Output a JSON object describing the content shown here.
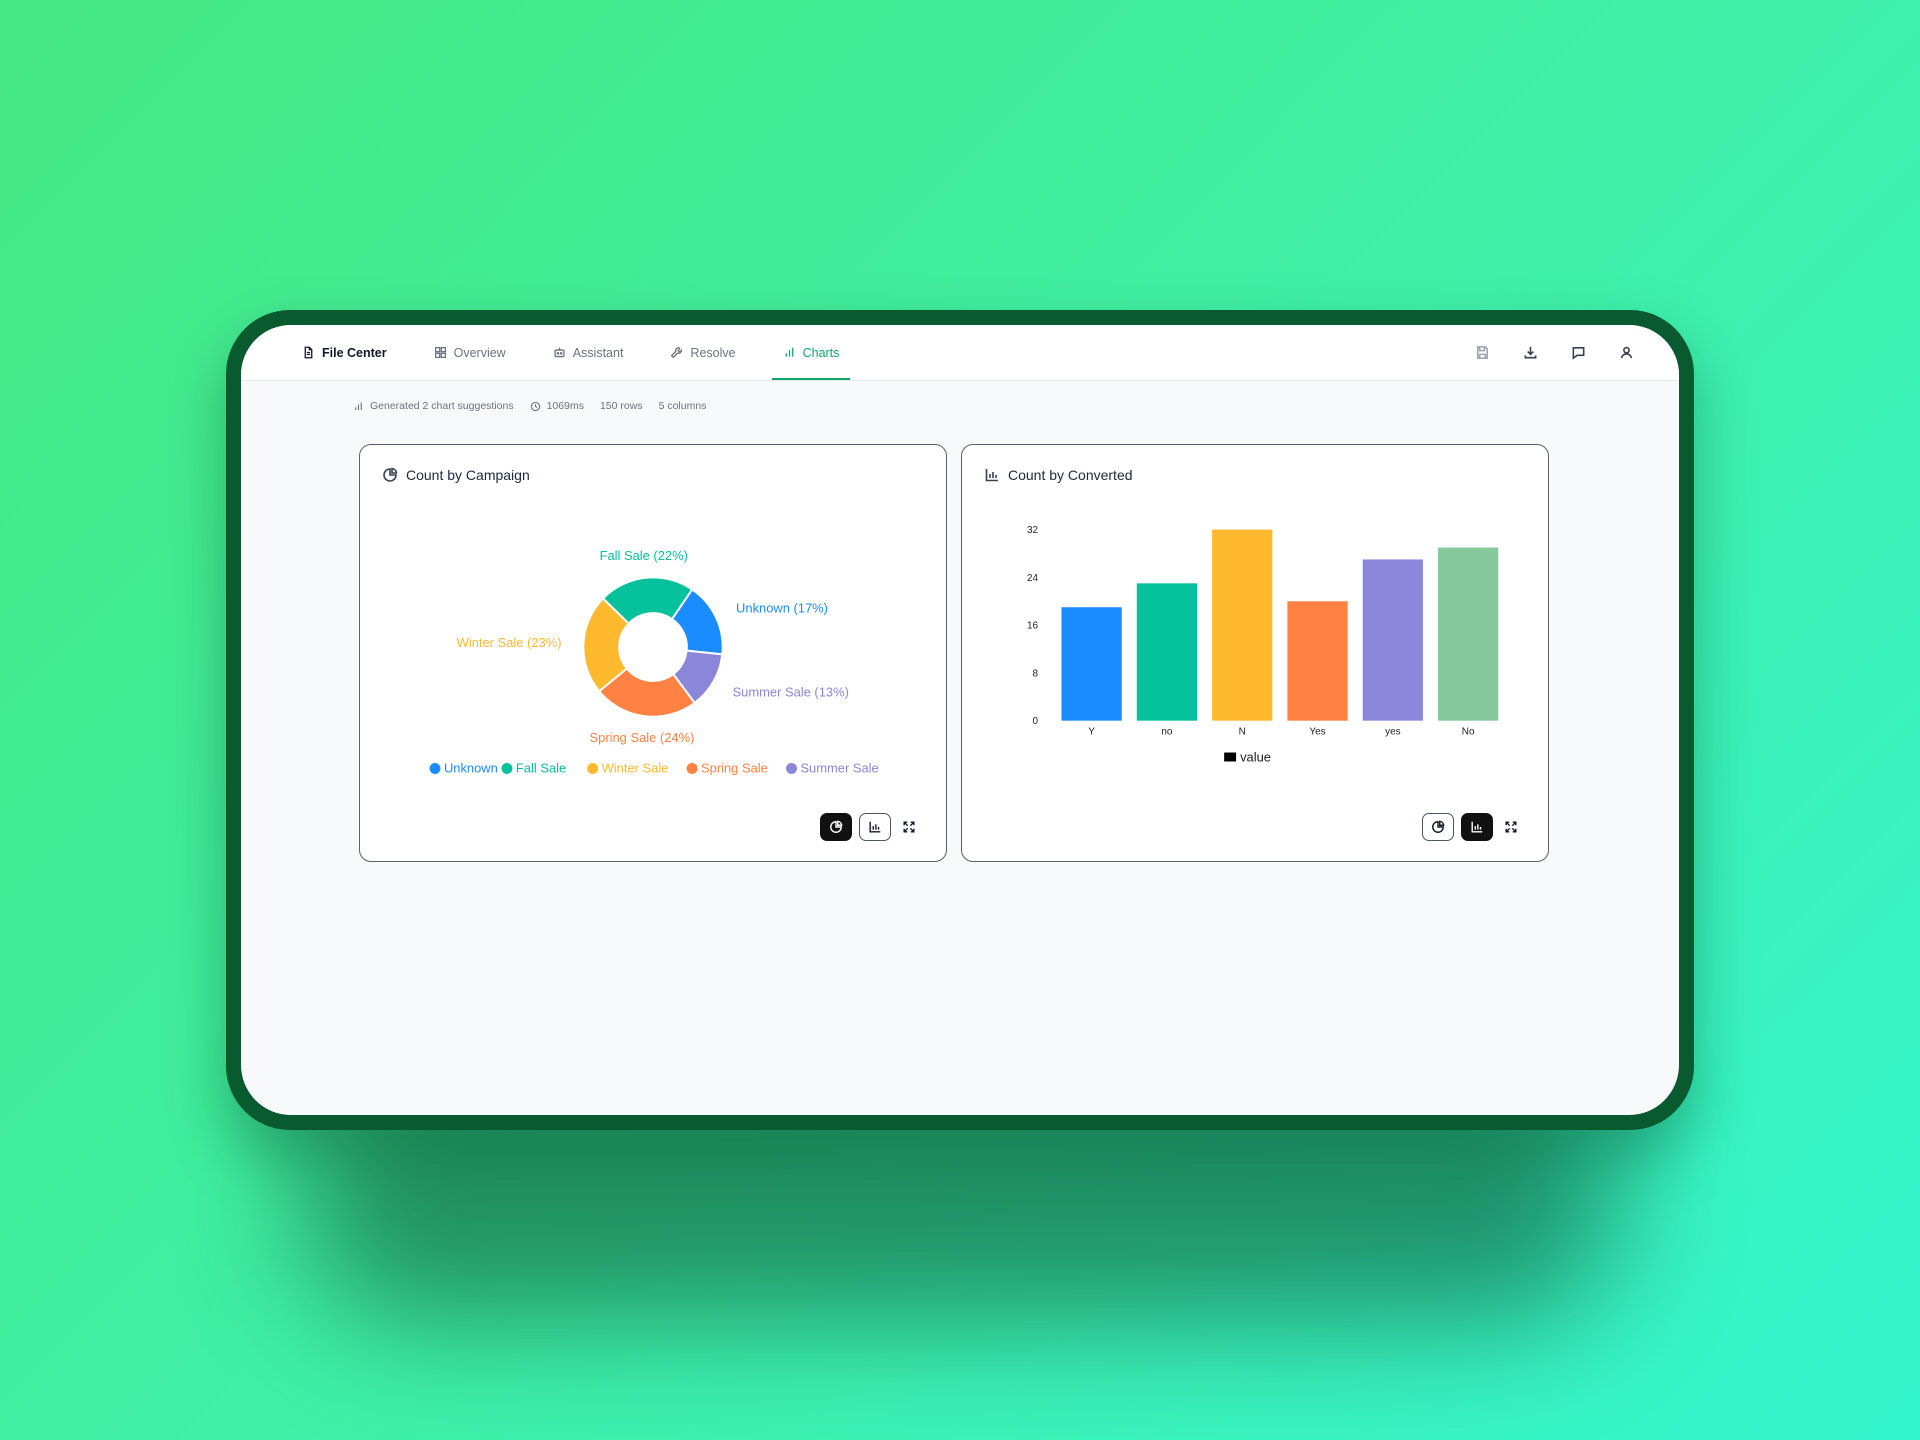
{
  "nav": {
    "tabs": [
      {
        "label": "File Center",
        "icon": "file-icon"
      },
      {
        "label": "Overview",
        "icon": "grid-icon"
      },
      {
        "label": "Assistant",
        "icon": "robot-icon"
      },
      {
        "label": "Resolve",
        "icon": "wrench-icon"
      },
      {
        "label": "Charts",
        "icon": "bar-chart-icon"
      }
    ],
    "active_tab": "Charts",
    "actions": [
      "save-icon",
      "download-icon",
      "comment-icon",
      "user-icon"
    ]
  },
  "meta": {
    "suggestions": "Generated 2 chart suggestions",
    "duration": "1069ms",
    "rows": "150 rows",
    "columns": "5 columns"
  },
  "colors": {
    "accent": "#10a56b",
    "blue": "#1a8cff",
    "teal": "#05c19c",
    "yellow": "#ffb92e",
    "orange": "#ff8243",
    "purple": "#8c86db",
    "green": "#85c99d"
  },
  "chart_data": [
    {
      "type": "pie",
      "title": "Count by Campaign",
      "categories": [
        "Unknown",
        "Summer Sale",
        "Spring Sale",
        "Winter Sale",
        "Fall Sale"
      ],
      "values": [
        17,
        13,
        24,
        23,
        22
      ],
      "slice_labels": [
        "Unknown (17%)",
        "Summer Sale (13%)",
        "Spring Sale (24%)",
        "Winter Sale (23%)",
        "Fall Sale (22%)"
      ],
      "colors": [
        "#1a8cff",
        "#8c86db",
        "#ff8243",
        "#ffb92e",
        "#05c19c"
      ],
      "legend": [
        "Unknown",
        "Fall Sale",
        "Winter Sale",
        "Spring Sale",
        "Summer Sale"
      ],
      "legend_colors": [
        "#1a8cff",
        "#05c19c",
        "#ffb92e",
        "#ff8243",
        "#8c86db"
      ],
      "legend_position": "bottom",
      "donut": true
    },
    {
      "type": "bar",
      "title": "Count by Converted",
      "categories": [
        "Y",
        "no",
        "N",
        "Yes",
        "yes",
        "No"
      ],
      "values": [
        19,
        23,
        32,
        20,
        27,
        29
      ],
      "colors": [
        "#1a8cff",
        "#05c19c",
        "#ffb92e",
        "#ff8243",
        "#8c86db",
        "#85c99d"
      ],
      "yticks": [
        0,
        8,
        16,
        24,
        32
      ],
      "ylim": [
        0,
        32
      ],
      "legend": "value",
      "legend_position": "bottom"
    }
  ]
}
